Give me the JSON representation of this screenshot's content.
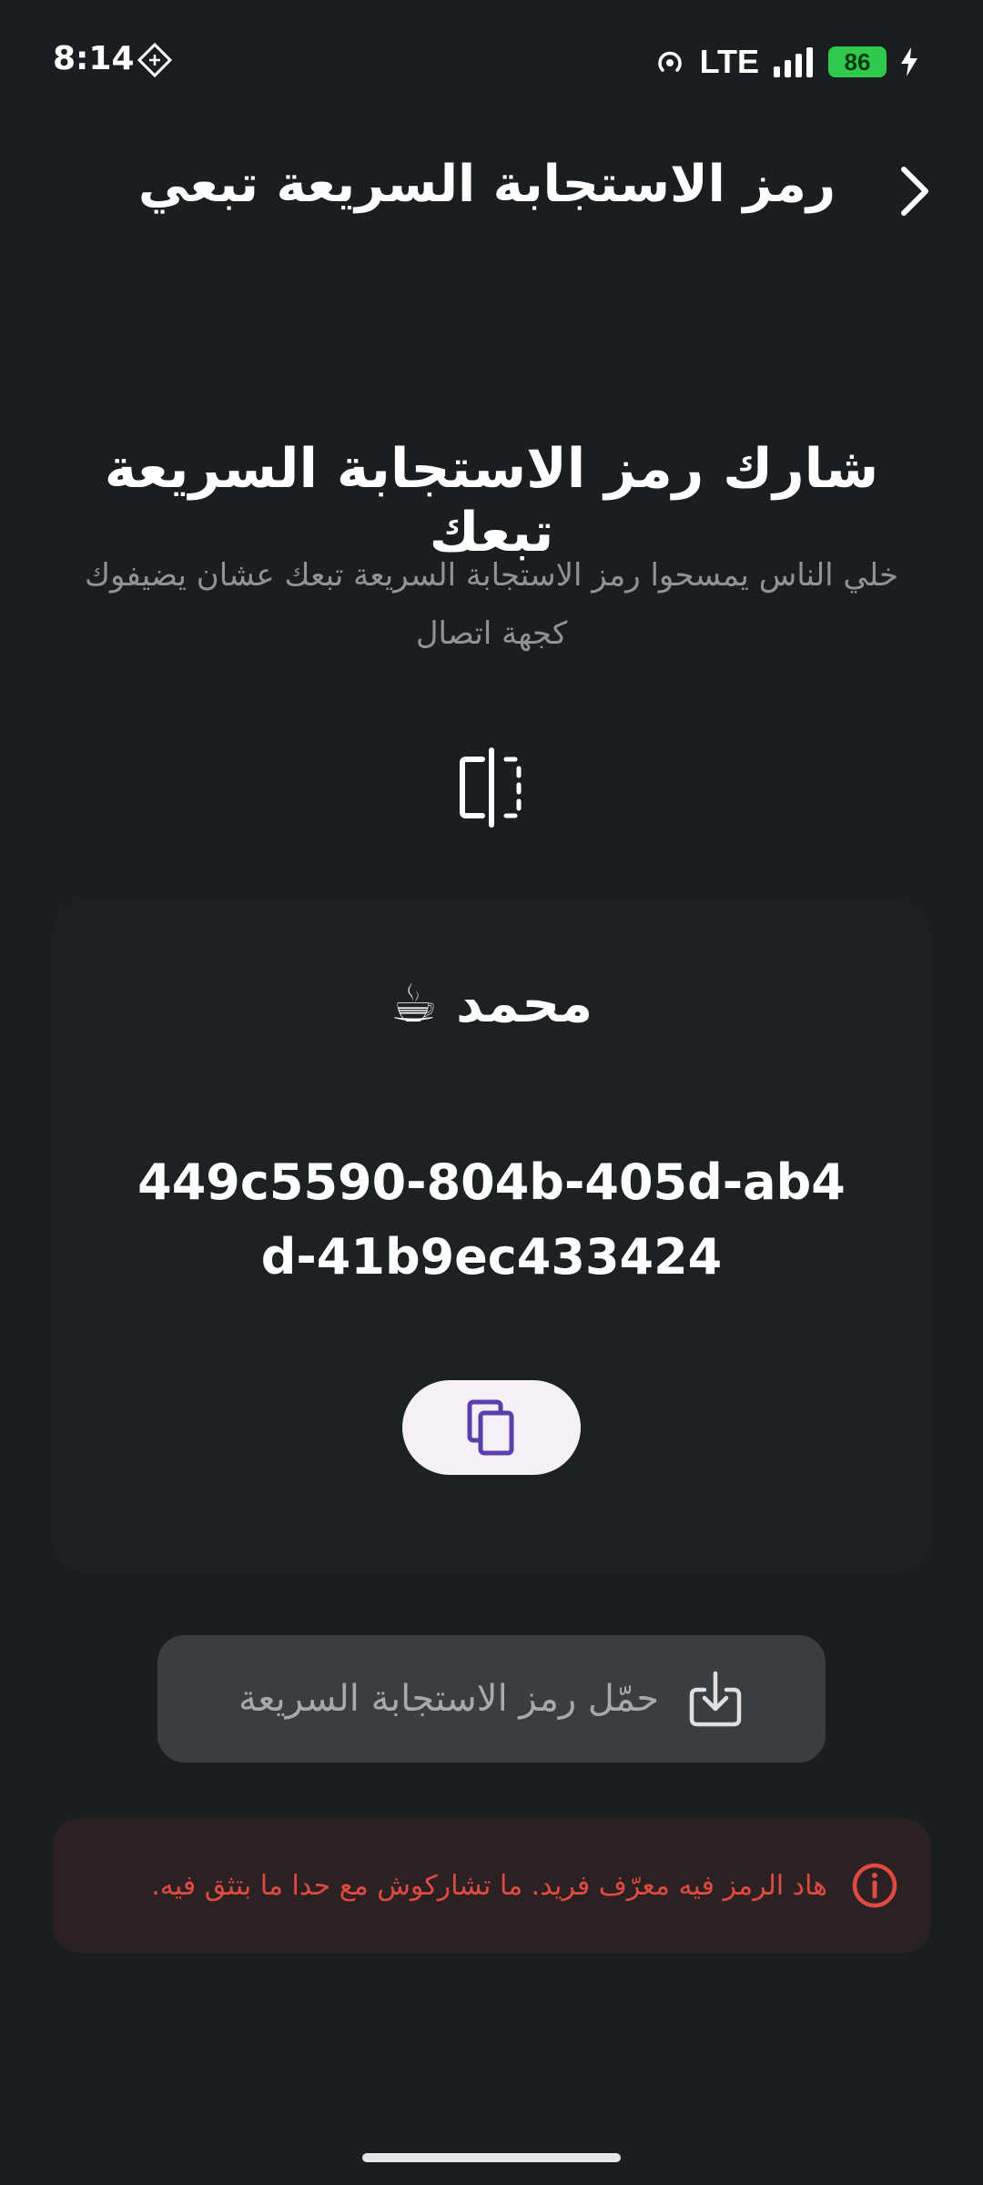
{
  "status_bar": {
    "time": "8:14",
    "network": "LTE",
    "battery": "86",
    "icons": [
      "notification-icon",
      "hotspot-icon",
      "signal-icon",
      "charging-bolt-icon"
    ]
  },
  "header": {
    "title": "رمز الاستجابة السريعة تبعي",
    "back_icon": "chevron-right-icon"
  },
  "share": {
    "title": "شارك رمز الاستجابة السريعة تبعك",
    "subtitle": "خلي الناس يمسحوا رمز الاستجابة السريعة تبعك عشان يضيفوك كجهة اتصال"
  },
  "card": {
    "name": "محمد ☕",
    "id": "449c5590-804b-405d-ab4d-41b9ec433424",
    "copy_icon": "copy-icon"
  },
  "download": {
    "label": "حمّل رمز الاستجابة السريعة",
    "icon": "download-icon"
  },
  "warning": {
    "text": "هاد الرمز فيه معرّف فريد. ما تشاركوش مع حدا ما بتثق فيه.",
    "icon": "info-icon"
  },
  "colors": {
    "background": "#1a1e20",
    "warning_text": "#e04a40",
    "copy_accent": "#5b3fa8",
    "battery": "#2fc94e"
  }
}
